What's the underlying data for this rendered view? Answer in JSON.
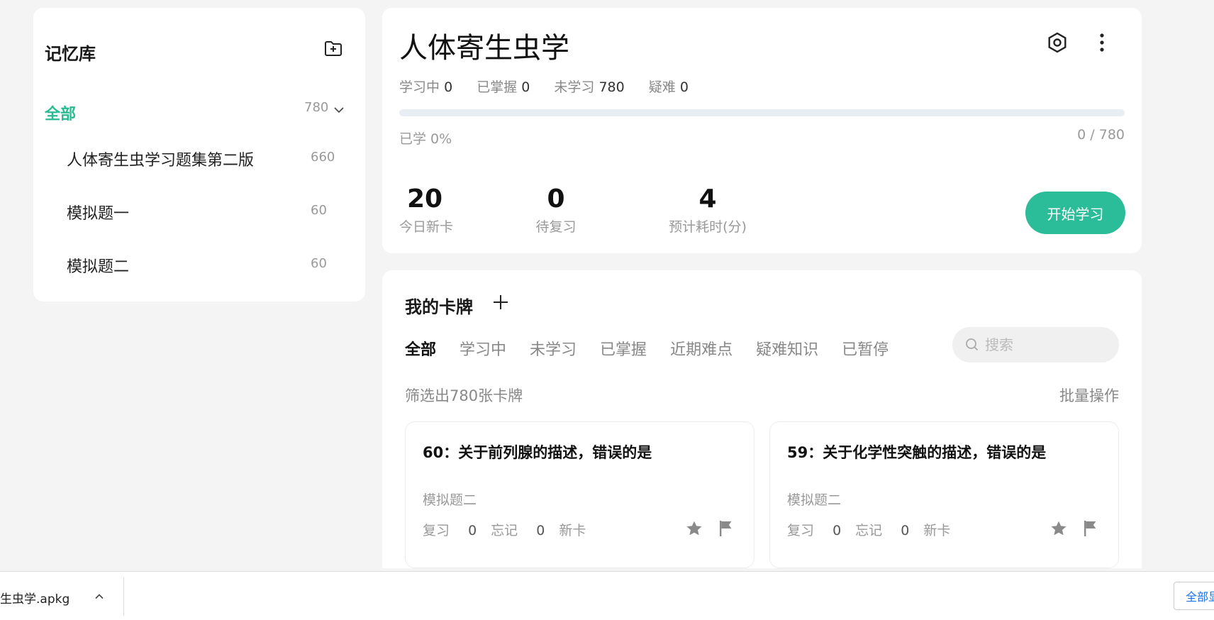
{
  "sidebar": {
    "title": "记忆库",
    "all_label": "全部",
    "all_count": "780",
    "decks": [
      {
        "name": "人体寄生虫学习题集第二版",
        "count": "660"
      },
      {
        "name": "模拟题一",
        "count": "60"
      },
      {
        "name": "模拟题二",
        "count": "60"
      }
    ]
  },
  "deck": {
    "title": "人体寄生虫学",
    "stats": [
      {
        "label": "学习中",
        "value": "0"
      },
      {
        "label": "已掌握",
        "value": "0"
      },
      {
        "label": "未学习",
        "value": "780"
      },
      {
        "label": "疑难",
        "value": "0"
      }
    ],
    "progress_fraction": 0,
    "learned_text": "已学 0%",
    "ratio_text": "0 / 780",
    "metrics": [
      {
        "value": "20",
        "label": "今日新卡"
      },
      {
        "value": "0",
        "label": "待复习"
      },
      {
        "value": "4",
        "label": "预计耗时(分)"
      }
    ],
    "start_label": "开始学习"
  },
  "cards": {
    "title": "我的卡牌",
    "tabs": [
      "全部",
      "学习中",
      "未学习",
      "已掌握",
      "近期难点",
      "疑难知识",
      "已暂停"
    ],
    "active_tab": "全部",
    "search_placeholder": "搜索",
    "filter_text": "筛选出780张卡牌",
    "batch_label": "批量操作",
    "items": [
      {
        "question": "60：关于前列腺的描述，错误的是",
        "deck": "模拟题二",
        "review_label": "复习",
        "review_value": "0",
        "forget_label": "忘记",
        "forget_value": "0",
        "status": "新卡"
      },
      {
        "question": "59：关于化学性突触的描述，错误的是",
        "deck": "模拟题二",
        "review_label": "复习",
        "review_value": "0",
        "forget_label": "忘记",
        "forget_value": "0",
        "status": "新卡"
      }
    ]
  },
  "download_bar": {
    "filename": "生虫学.apkg",
    "show_all_label": "全部显"
  },
  "colors": {
    "accent": "#2bbc99",
    "background": "#f4f4f4",
    "panel": "#ffffff",
    "progress_track": "#e9edf4",
    "icon_gray": "#8a8a8a"
  },
  "icons": [
    "folder-add-icon",
    "chevron-down-icon",
    "settings-icon",
    "more-vertical-icon",
    "plus-icon",
    "search-icon",
    "star-icon",
    "flag-icon",
    "chevron-up-icon"
  ]
}
